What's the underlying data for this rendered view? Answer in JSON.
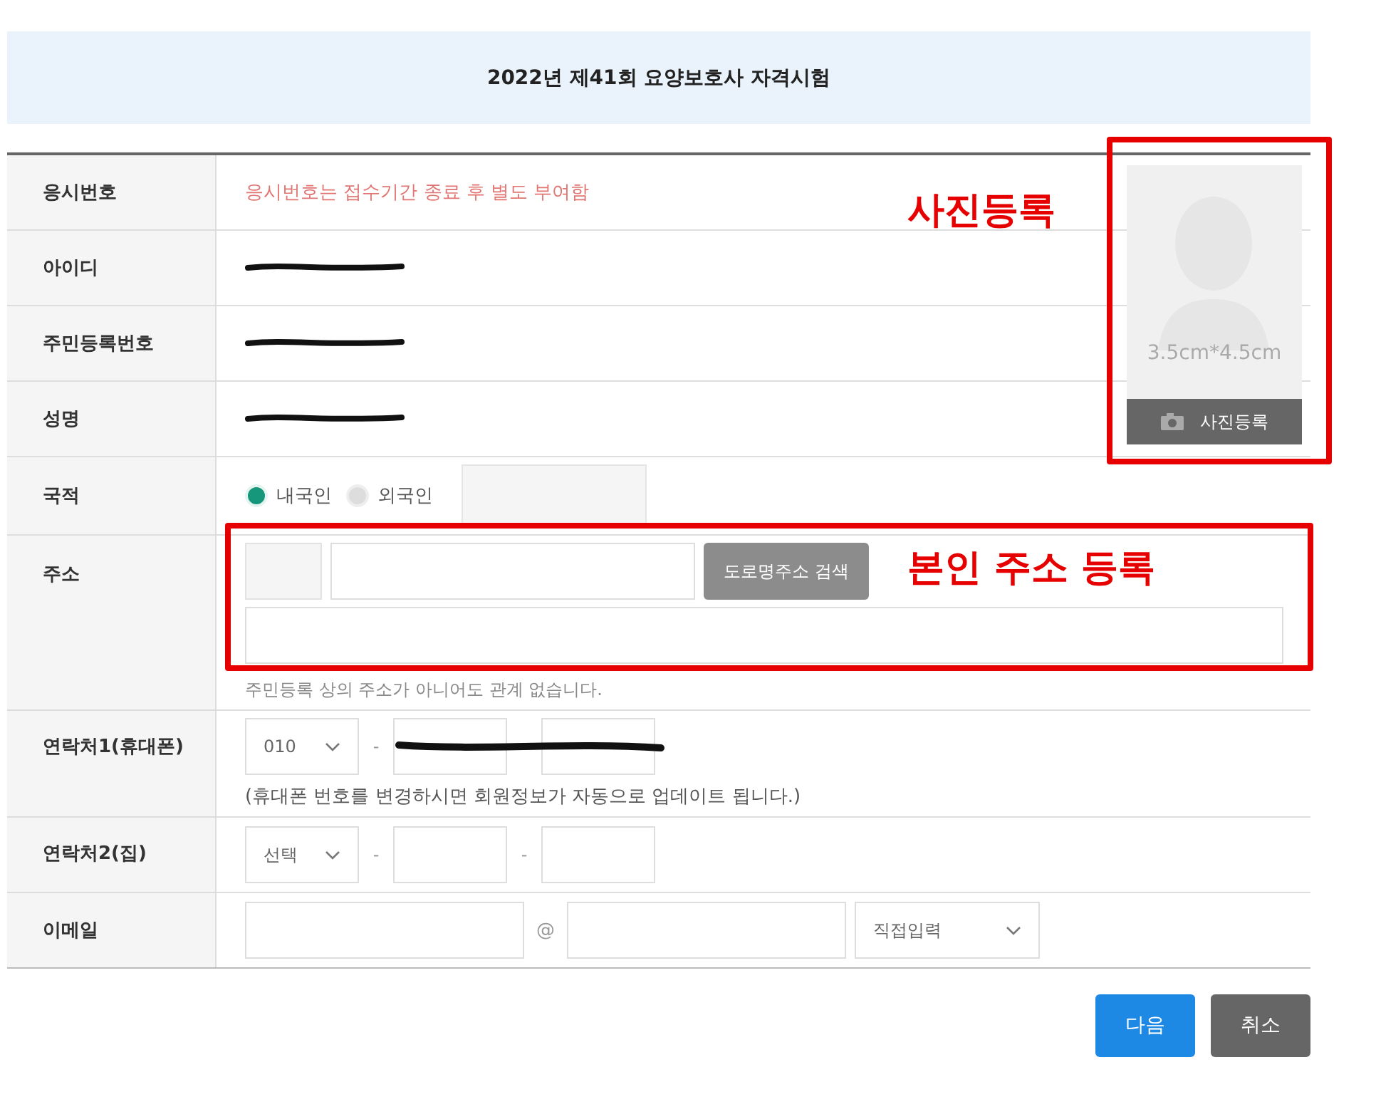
{
  "header": {
    "title": "2022년 제41회 요양보호사 자격시험"
  },
  "rows": [
    {
      "kind": "notice",
      "label": "응시번호",
      "text": "응시번호는 접수기간 종료 후 별도 부여함"
    },
    {
      "kind": "redacted",
      "label": "아이디"
    },
    {
      "kind": "redacted",
      "label": "주민등록번호"
    },
    {
      "kind": "redacted",
      "label": "성명"
    },
    {
      "kind": "radio",
      "label": "국적",
      "options": [
        {
          "label": "내국인",
          "selected": true
        },
        {
          "label": "외국인",
          "selected": false
        }
      ]
    },
    {
      "kind": "address",
      "label": "주소",
      "button": "도로명주소 검색",
      "hint": "주민등록 상의 주소가 아니어도 관계 없습니다."
    },
    {
      "kind": "phone",
      "label": "연락처1(휴대폰)",
      "select": "010",
      "separators": [
        "-"
      ],
      "redacted": true,
      "note": "(휴대폰 번호를 변경하시면 회원정보가 자동으로 업데이트 됩니다.)"
    },
    {
      "kind": "phone",
      "label": "연락처2(집)",
      "select": "선택",
      "separators": [
        "-",
        "-"
      ],
      "redacted": false
    },
    {
      "kind": "email",
      "label": "이메일",
      "at": "@",
      "select": "직접입력"
    }
  ],
  "photo": {
    "size": "3.5cm*4.5cm",
    "button": "사진등록"
  },
  "annotations": [
    {
      "kind": "photo",
      "text": "사진등록"
    },
    {
      "kind": "address",
      "text": "본인 주소 등록"
    }
  ],
  "buttons": [
    {
      "label": "다음",
      "kind": "primary"
    },
    {
      "label": "취소",
      "kind": "secondary"
    }
  ]
}
